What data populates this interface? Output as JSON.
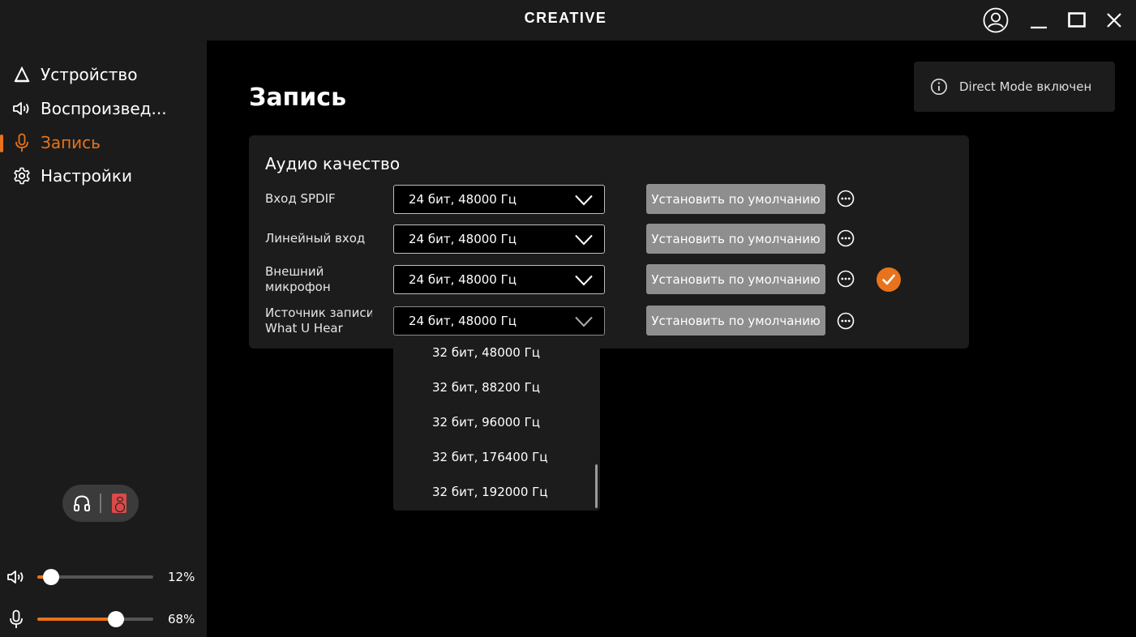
{
  "app": {
    "brand": "CREATIVE"
  },
  "sidebar": {
    "items": [
      {
        "label": "Устройство",
        "icon": "device-icon",
        "active": false
      },
      {
        "label": "Воспроизвед...",
        "icon": "speaker-icon",
        "active": false
      },
      {
        "label": "Запись",
        "icon": "microphone-icon",
        "active": true
      },
      {
        "label": "Настройки",
        "icon": "gear-icon",
        "active": false
      }
    ],
    "output_toggle": {
      "left_icon": "headphones-icon",
      "right_icon": "speaker-box-icon",
      "selected": "speaker"
    },
    "volume": {
      "icon": "volume-icon",
      "value_text": "12%",
      "level": 0.12
    },
    "mic": {
      "icon": "microphone-icon",
      "value_text": "68%",
      "level": 0.68
    }
  },
  "page": {
    "title": "Запись"
  },
  "toast": {
    "icon": "info-icon",
    "text": "Direct Mode включен"
  },
  "card": {
    "title": "Аудио качество",
    "rows": [
      {
        "label_lines": [
          "Вход SPDIF"
        ],
        "value": "24 бит, 48000 Гц",
        "button": "Установить по умолчанию",
        "checked": false
      },
      {
        "label_lines": [
          "Линейный вход"
        ],
        "value": "24 бит, 48000 Гц",
        "button": "Установить по умолчанию",
        "checked": false
      },
      {
        "label_lines": [
          "Внешний",
          "микрофон"
        ],
        "value": "24 бит, 48000 Гц",
        "button": "Установить по умолчанию",
        "checked": true
      },
      {
        "label_lines": [
          "Источник записи",
          "What U Hear"
        ],
        "value": "24 бит, 48000 Гц",
        "button": "Установить по умолчанию",
        "checked": false
      }
    ]
  },
  "dropdown": {
    "options": [
      "32 бит, 48000 Гц",
      "32 бит, 88200 Гц",
      "32 бит, 96000 Гц",
      "32 бит, 176400 Гц",
      "32 бит, 192000 Гц"
    ]
  },
  "colors": {
    "accent": "#e8731c",
    "sidebar_bg": "#1b1b1b",
    "card_bg": "#1c1c1c",
    "button_bg": "#8e8e8e"
  }
}
